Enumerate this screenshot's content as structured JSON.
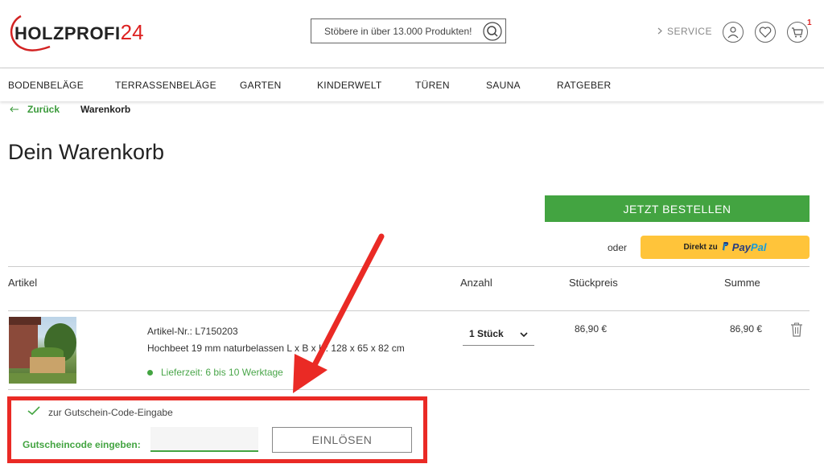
{
  "header": {
    "logo_text": "HOLZPROFI",
    "logo_number": "24",
    "search_placeholder": "Stöbere in über 13.000 Produkten!",
    "service_label": "SERVICE",
    "cart_count": "1"
  },
  "nav": {
    "items": [
      "BODENBELÄGE",
      "TERRASSENBELÄGE",
      "GARTEN",
      "KINDERWELT",
      "TÜREN",
      "SAUNA",
      "RATGEBER"
    ]
  },
  "breadcrumb": {
    "back_label": "Zurück",
    "current": "Warenkorb"
  },
  "page_title": "Dein Warenkorb",
  "checkout": {
    "order_button": "JETZT BESTELLEN",
    "or_label": "oder",
    "paypal_direct": "Direkt zu",
    "paypal_pay": "Pay",
    "paypal_pal": "Pal"
  },
  "table": {
    "headers": {
      "article": "Artikel",
      "quantity": "Anzahl",
      "unit_price": "Stückpreis",
      "total": "Summe"
    },
    "rows": [
      {
        "article_nr": "Artikel-Nr.: L7150203",
        "name": "Hochbeet 19 mm naturbelassen L x B x H: 128 x 65 x 82 cm",
        "delivery": "Lieferzeit: 6 bis 10 Werktage",
        "quantity": "1 Stück",
        "unit_price": "86,90 €",
        "total": "86,90 €"
      }
    ]
  },
  "voucher": {
    "toggle_label": "zur Gutschein-Code-Eingabe",
    "input_label": "Gutscheincode eingeben:",
    "input_value": "",
    "redeem_button": "EINLÖSEN"
  },
  "colors": {
    "brand_green": "#43a441",
    "logo_red": "#d22222",
    "paypal_yellow": "#ffc43a",
    "annotation_red": "#ea2a25"
  }
}
